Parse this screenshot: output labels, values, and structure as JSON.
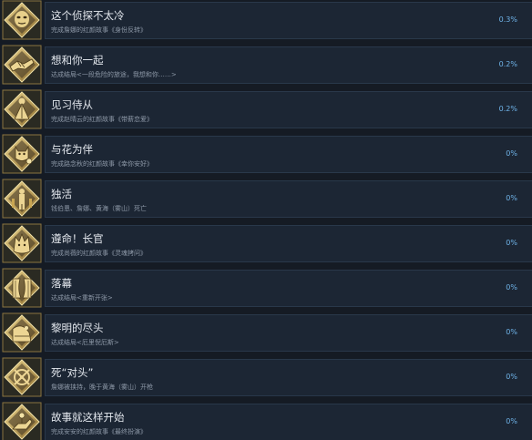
{
  "colors": {
    "background": "#151b24",
    "panel": "#1c2634",
    "title_text": "#e4e8ee",
    "description_text": "#8e99a8",
    "percent_text": "#6fb3e8",
    "badge_gold": "#c9a652"
  },
  "achievements": [
    {
      "icon": "mask-badge-icon",
      "title": "这个侦探不太冷",
      "description": "完成詹娜的红颜故事《身份反转》",
      "percent": "0.3%"
    },
    {
      "icon": "handshake-badge-icon",
      "title": "想和你一起",
      "description": "达成结局<一段危险的旅途，我想和你……>",
      "percent": "0.2%"
    },
    {
      "icon": "cloak-figure-badge-icon",
      "title": "见习侍从",
      "description": "完成赵晴云的红颜故事《带薪恋爱》",
      "percent": "0.2%"
    },
    {
      "icon": "cat-flower-badge-icon",
      "title": "与花为伴",
      "description": "完成路念秋的红颜故事《幸你安好》",
      "percent": "0%"
    },
    {
      "icon": "lone-figure-badge-icon",
      "title": "独活",
      "description": "钱伯恩、詹娜、黄海（雾山）死亡",
      "percent": "0%"
    },
    {
      "icon": "wolf-head-badge-icon",
      "title": "遵命！长官",
      "description": "完成尚薇的红颜故事《灵魂拷问》",
      "percent": "0%"
    },
    {
      "icon": "curtain-badge-icon",
      "title": "落幕",
      "description": "达成结局<重新开张>",
      "percent": "0%"
    },
    {
      "icon": "horizon-badge-icon",
      "title": "黎明的尽头",
      "description": "达成结局<厄里倪厄斯>",
      "percent": "0%"
    },
    {
      "icon": "crossed-target-badge-icon",
      "title": "死“对头”",
      "description": "詹娜被挟持，晚于黄海（雾山）开枪",
      "percent": "0%"
    },
    {
      "icon": "hand-flower-badge-icon",
      "title": "故事就这样开始",
      "description": "完成安安的红颜故事《最终扮演》",
      "percent": "0%"
    }
  ]
}
